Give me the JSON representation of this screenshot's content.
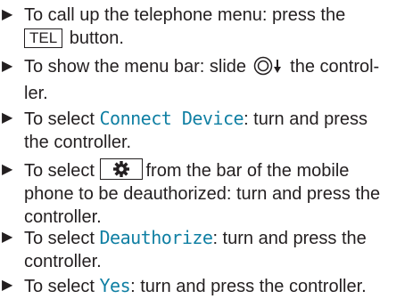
{
  "steps": [
    {
      "bullet": "▶",
      "line1_pre": "To call up the telephone menu: press the",
      "key_label": "TEL",
      "line2_post": " button."
    },
    {
      "bullet": "▶",
      "line1_pre": "To show the menu bar: slide",
      "line1_post": "the control-",
      "line2": "ler."
    },
    {
      "bullet": "▶",
      "line1_pre": "To select ",
      "term": "Connect Device",
      "line1_post": ": turn and press",
      "line2": "the controller."
    },
    {
      "bullet": "▶",
      "line1_pre": "To select",
      "line1_post": "from the bar of the mobile",
      "line2": "phone to be deauthorized: turn and press the",
      "line3": "controller."
    },
    {
      "bullet": "▶",
      "line1_pre": "To select ",
      "term": "Deauthorize",
      "line1_post": ": turn and press the",
      "line2": "controller."
    },
    {
      "bullet": "▶",
      "line1_pre": "To select ",
      "term": "Yes",
      "line1_post": ": turn and press the controller."
    }
  ],
  "icons": {
    "controller": "controller-slide-down-icon",
    "settings": "gear-icon"
  },
  "colors": {
    "text": "#231f20",
    "ui_term": "#0f7fa3"
  }
}
